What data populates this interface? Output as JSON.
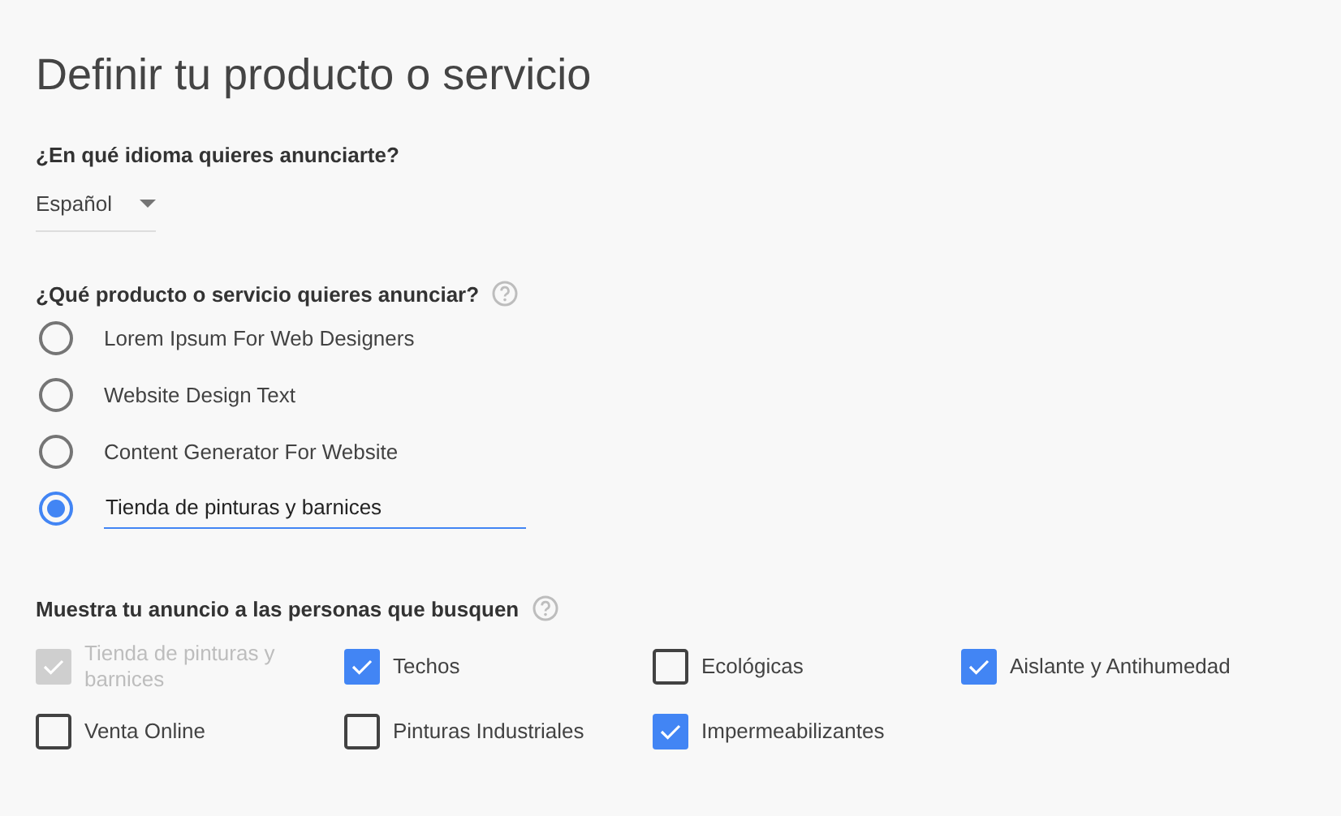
{
  "title": "Definir tu producto o servicio",
  "language": {
    "label": "¿En qué idioma quieres anunciarte?",
    "value": "Español"
  },
  "product": {
    "label": "¿Qué producto o servicio quieres anunciar?",
    "options": [
      {
        "kind": "option",
        "label": "Lorem Ipsum For Web Designers",
        "selected": false
      },
      {
        "kind": "option",
        "label": "Website Design Text",
        "selected": false
      },
      {
        "kind": "option",
        "label": "Content Generator For Website",
        "selected": false
      },
      {
        "kind": "input",
        "value": "Tienda de pinturas y barnices",
        "selected": true
      }
    ]
  },
  "keywords": {
    "label": "Muestra tu anuncio a las personas que busquen",
    "items": [
      {
        "label": "Tienda de pinturas y barnices",
        "checked": true,
        "disabled": true
      },
      {
        "label": "Techos",
        "checked": true,
        "disabled": false
      },
      {
        "label": "Ecológicas",
        "checked": false,
        "disabled": false
      },
      {
        "label": "Aislante y Antihumedad",
        "checked": true,
        "disabled": false
      },
      {
        "label": "Venta Online",
        "checked": false,
        "disabled": false
      },
      {
        "label": "Pinturas Industriales",
        "checked": false,
        "disabled": false
      },
      {
        "label": "Impermeabilizantes",
        "checked": true,
        "disabled": false
      }
    ]
  }
}
